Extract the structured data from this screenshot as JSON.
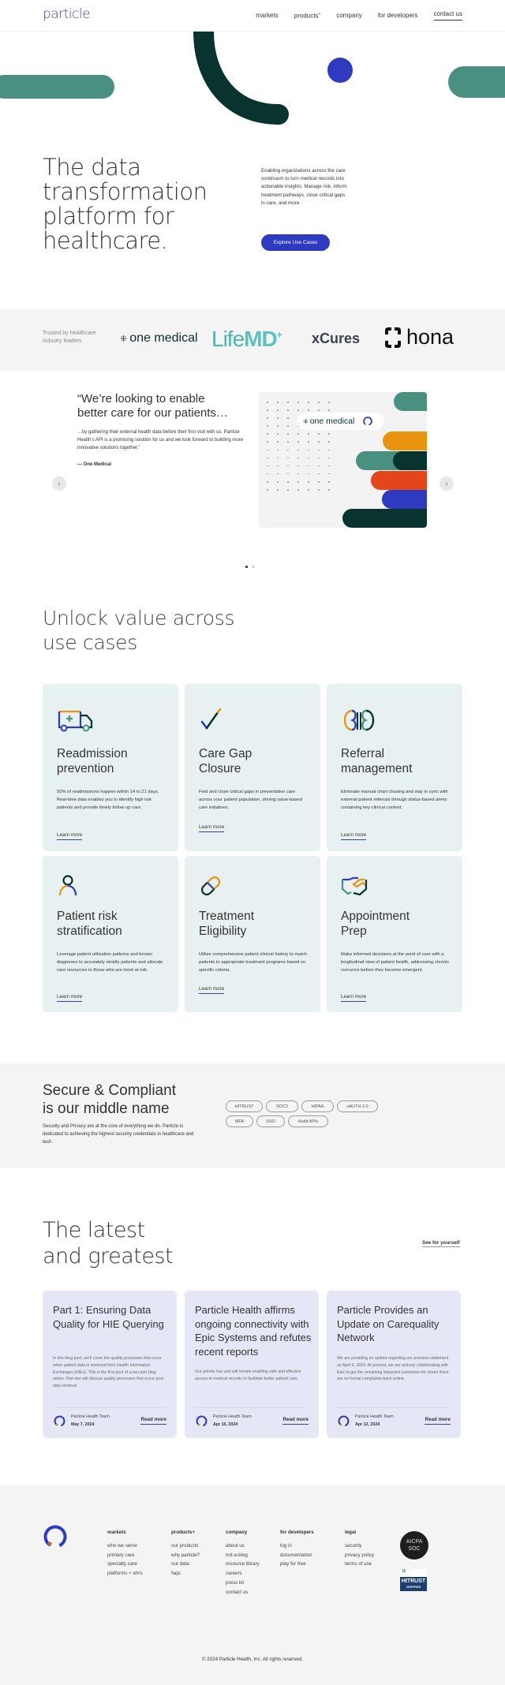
{
  "header": {
    "logo": "particle",
    "nav": [
      {
        "label": "markets"
      },
      {
        "label": "products",
        "suffix": "+"
      },
      {
        "label": "company"
      },
      {
        "label": "for developers"
      },
      {
        "label": "contact us"
      }
    ]
  },
  "hero": {
    "title_lines": [
      "The data",
      "transformation",
      "platform for",
      "healthcare."
    ],
    "description": "Enabling organizations across the care continuum to turn medical records into actionable insights. Manage risk, inform treatment pathways, close critical gaps in care, and more.",
    "cta_label": "Explore Use Cases"
  },
  "trusted": {
    "label": "Trusted by healthcare industry leaders",
    "logos": {
      "one_medical": "one medical",
      "lifemd_a": "Life",
      "lifemd_b": "MD",
      "xcures": "xCures",
      "hona": "hona"
    }
  },
  "testimonial": {
    "headline_lines": [
      "“We’re looking to enable",
      "better care for our patients…"
    ],
    "body": "…by gathering their external health data before their first visit with us. Particle Health’s API is a promising solution for us and we look forward to building more innovative solutions together.”",
    "author": "— One Medical",
    "image_chip_label": "one medical",
    "prev_icon": "‹",
    "next_icon": "›",
    "pages": 2,
    "active_page": 1
  },
  "use_cases": {
    "title_lines": [
      "Unlock value across",
      "use cases"
    ],
    "learn_more_label": "Learn more",
    "cards": [
      {
        "icon": "ambulance-icon",
        "title_lines": [
          "Readmission",
          "prevention"
        ],
        "body": "50% of readmissions happen within 14 to 21 days. Real-time data enables you to identify high risk patients and provide timely follow up care."
      },
      {
        "icon": "checkmark-icon",
        "title_lines": [
          "Care Gap",
          "Closure"
        ],
        "body": "Find and close critical gaps in preventative care across your patient population, driving value-based care initiatives."
      },
      {
        "icon": "kidneys-icon",
        "title_lines": [
          "Referral",
          "management"
        ],
        "body": "Eliminate manual chart chasing and stay in sync with external patient referrals through status-based alerts containing key clinical context."
      },
      {
        "icon": "person-icon",
        "title_lines": [
          "Patient risk",
          "stratification"
        ],
        "body": "Leverage patient utilization patterns and known diagnoses to accurately stratify patients and allocate care resources to those who are most at risk."
      },
      {
        "icon": "pill-icon",
        "title_lines": [
          "Treatment",
          "Eligibility"
        ],
        "body": "Utilize comprehensive patient clinical history to match patients to appropriate treatment programs based on specific criteria."
      },
      {
        "icon": "handshake-icon",
        "title_lines": [
          "Appointment",
          "Prep"
        ],
        "body": "Make informed decisions at the point of care with a longitudinal view of patient health, addressing chronic concerns before they become emergent."
      }
    ]
  },
  "secure": {
    "title_lines": [
      "Secure & Compliant",
      "is our middle name"
    ],
    "body": "Security and Privacy are at the core of everything we do. Particle is dedicated to achieving the highest security credentials in healthcare and tech.",
    "badges": [
      "HITRUST",
      "SOC2",
      "HIPAA",
      "oAUTH 2.0",
      "MFA",
      "SSO",
      "Audit APIs"
    ]
  },
  "latest": {
    "title_lines": [
      "The latest",
      "and greatest"
    ],
    "see_link": "See for yourself",
    "read_more_label": "Read more",
    "posts": [
      {
        "title": "Part 1: Ensuring Data Quality for HIE Querying",
        "excerpt": "In this blog post, we’ll cover the quality processes that occur when patient data is retrieved from Health Information Exchanges (HIEs). This is the first post of a two part blog series. Part two will discuss quality processes that occur post data retrieval.",
        "author": "Particle Health Team",
        "date": "May 7, 2024"
      },
      {
        "title": "Particle Health affirms ongoing connectivity with Epic Systems and refutes recent reports",
        "excerpt": "Our priority has and will remain enabling safe and effective access to medical records to facilitate better patient care.",
        "author": "Particle Health Team",
        "date": "Apr 15, 2024"
      },
      {
        "title": "Particle Provides an Update on Carequality Network",
        "excerpt": "We are providing an update regarding our previous statement on April 9, 2024. At present, we are actively collaborating with Epic to get the remaining impacted customers-for whom there are no formal complaints-back online.",
        "author": "Particle Health Team",
        "date": "Apr 12, 2024"
      }
    ]
  },
  "footer": {
    "columns": [
      {
        "heading": "markets",
        "links": [
          "who we serve",
          "primary care",
          "specialty care",
          "platforms + ehrs"
        ]
      },
      {
        "heading": "products+",
        "links": [
          "our products",
          "why particle?",
          "our data",
          "faqs"
        ]
      },
      {
        "heading": "company",
        "links": [
          "about us",
          "not-a-blog",
          "resource library",
          "careers",
          "press kit",
          "contact us"
        ]
      },
      {
        "heading": "for developers",
        "links": [
          "log in",
          "documentation",
          "play for free"
        ]
      },
      {
        "heading": "legal",
        "links": [
          "security",
          "privacy policy",
          "terms of use"
        ]
      }
    ],
    "aicpa": {
      "line1": "AICPA",
      "line2": "SOC"
    },
    "hitrust": {
      "top": "i1",
      "main": "HITRUST",
      "sub": "CERTIFIED"
    },
    "copyright": "© 2024 Particle Health, Inc. All rights reserved."
  },
  "colors": {
    "brand_blue": "#2e3abf",
    "teal": "#4a9080",
    "dark_green": "#08332e",
    "orange": "#e8940f",
    "red": "#e2461a",
    "use_case_bg": "#e8f1f1",
    "blog_bg": "#e6e7f6"
  }
}
